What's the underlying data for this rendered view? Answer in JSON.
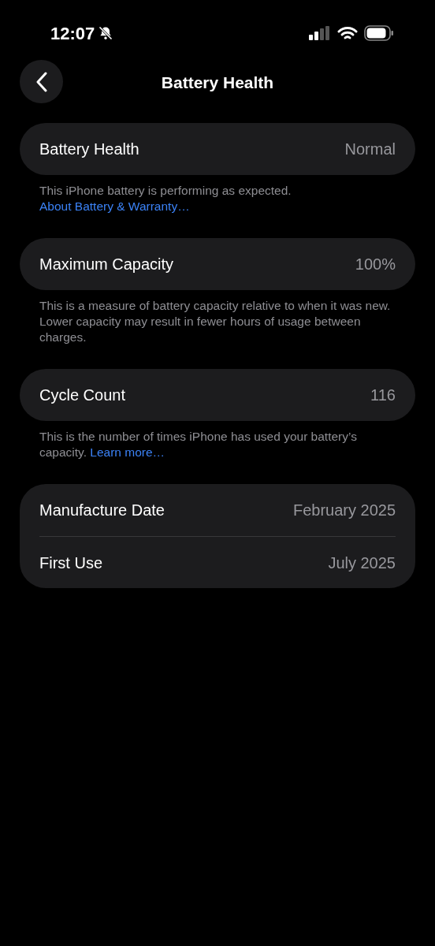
{
  "status_bar": {
    "time": "12:07",
    "silent": true
  },
  "nav": {
    "title": "Battery Health"
  },
  "groups": [
    {
      "rows": [
        {
          "label": "Battery Health",
          "value": "Normal"
        }
      ],
      "footer": {
        "text": "This iPhone battery is performing as expected.",
        "link": "About Battery & Warranty…"
      }
    },
    {
      "rows": [
        {
          "label": "Maximum Capacity",
          "value": "100%"
        }
      ],
      "footer": {
        "text": "This is a measure of battery capacity relative to when it was new. Lower capacity may result in fewer hours of usage between charges."
      }
    },
    {
      "rows": [
        {
          "label": "Cycle Count",
          "value": "116"
        }
      ],
      "footer": {
        "text": "This is the number of times iPhone has used your battery’s capacity.",
        "link": "Learn more…"
      }
    },
    {
      "rows": [
        {
          "label": "Manufacture Date",
          "value": "February 2025"
        },
        {
          "label": "First Use",
          "value": "July 2025"
        }
      ]
    }
  ]
}
